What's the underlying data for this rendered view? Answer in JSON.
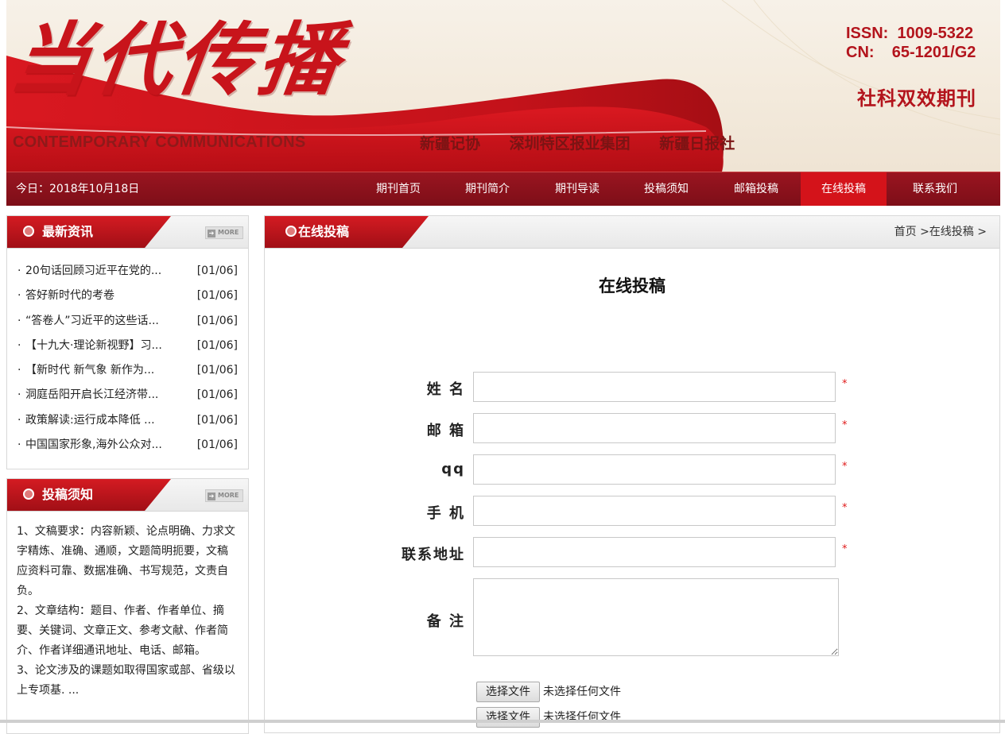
{
  "header": {
    "logo_cn": "当代传播",
    "logo_en": "CONTEMPORARY COMMUNICATIONS",
    "partners": [
      "新疆记协",
      "深圳特区报业集团",
      "新疆日报社"
    ],
    "issn_line": "ISSN:  1009-5322",
    "cn_line": "CN:    65-1201/G2",
    "slogan": "社科双效期刊"
  },
  "nav": {
    "today": "今日：2018年10月18日",
    "items": [
      "期刊首页",
      "期刊简介",
      "期刊导读",
      "投稿须知",
      "邮箱投稿",
      "在线投稿",
      "联系我们"
    ],
    "active": "在线投稿"
  },
  "sidebar": {
    "news": {
      "title": "最新资讯",
      "more": "MORE",
      "items": [
        {
          "title": "20句话回顾习近平在党的...",
          "date": "[01/06]"
        },
        {
          "title": "答好新时代的考卷",
          "date": "[01/06]"
        },
        {
          "title": "“答卷人”习近平的这些话...",
          "date": "[01/06]"
        },
        {
          "title": "【十九大·理论新视野】习...",
          "date": "[01/06]"
        },
        {
          "title": "【新时代 新气象 新作为...",
          "date": "[01/06]"
        },
        {
          "title": "洞庭岳阳开启长江经济带...",
          "date": "[01/06]"
        },
        {
          "title": "政策解读:运行成本降低 ...",
          "date": "[01/06]"
        },
        {
          "title": "中国国家形象,海外公众对...",
          "date": "[01/06]"
        }
      ]
    },
    "notice": {
      "title": "投稿须知",
      "more": "MORE",
      "paragraphs": [
        "1、文稿要求：内容新颖、论点明确、力求文字精炼、准确、通顺，文题简明扼要，文稿应资料可靠、数据准确、书写规范，文责自负。",
        "2、文章结构：题目、作者、作者单位、摘要、关键词、文章正文、参考文献、作者简介、作者详细通讯地址、电话、邮箱。",
        "3、论文涉及的课题如取得国家或部、省级以上专项基. ..."
      ]
    }
  },
  "main": {
    "section_title": "在线投稿",
    "breadcrumb": "首页 >在线投稿 >",
    "form_title": "在线投稿",
    "fields": [
      {
        "label": "姓 名",
        "value": "",
        "required": "*"
      },
      {
        "label": "邮 箱",
        "value": "",
        "required": "*"
      },
      {
        "label": "qq",
        "value": "",
        "required": "*"
      },
      {
        "label": "手 机",
        "value": "",
        "required": "*"
      },
      {
        "label": "联系地址",
        "value": "",
        "required": "*"
      }
    ],
    "remark_label": "备 注",
    "file_button": "选择文件",
    "file_status": "未选择任何文件"
  },
  "colors": {
    "brand_red": "#c8141b",
    "nav_bg": "#8a1119",
    "nav_active": "#d4131a",
    "required": "#e01818"
  }
}
